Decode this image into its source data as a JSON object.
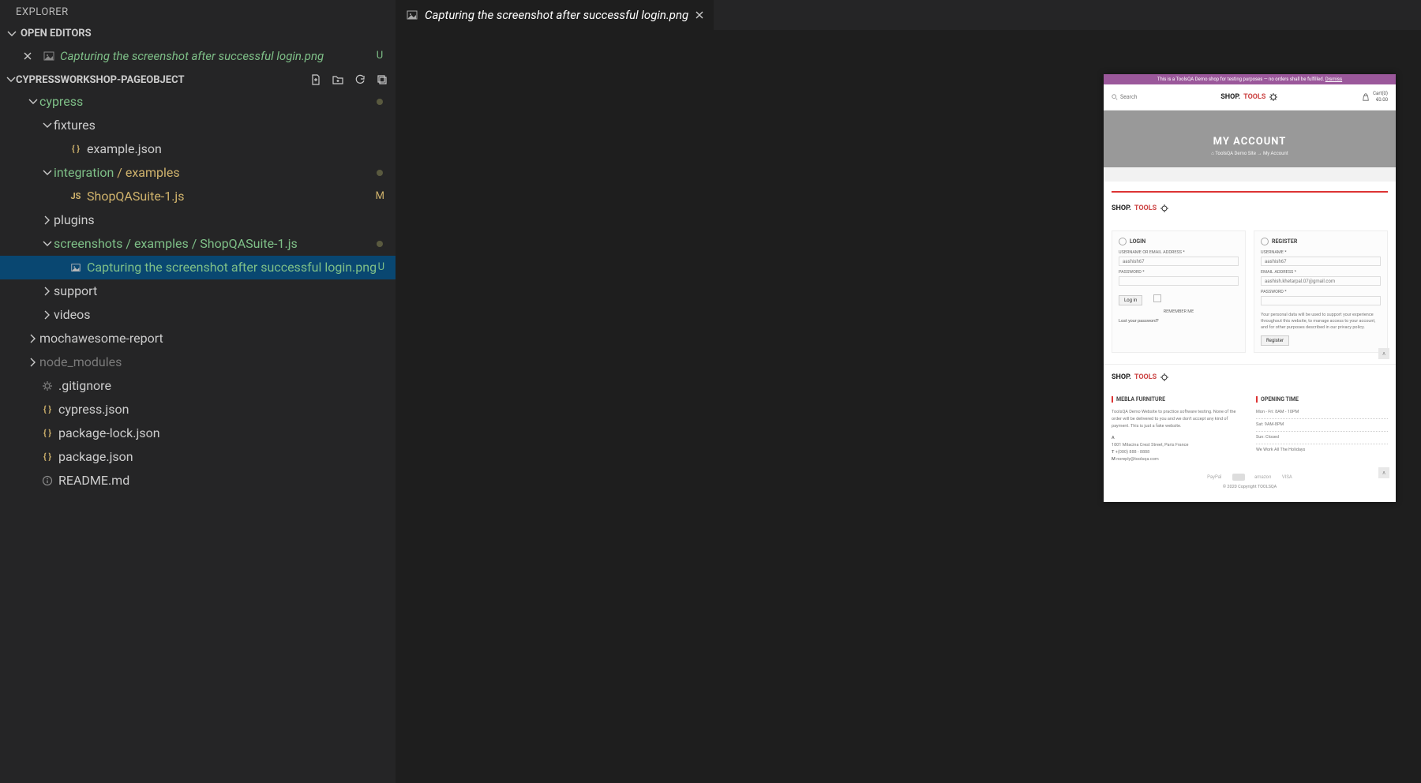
{
  "explorer": {
    "title": "EXPLORER",
    "open_editors_label": "OPEN EDITORS",
    "open_editor": {
      "name": "Capturing the screenshot after successful login.png",
      "status": "U"
    },
    "workspace": "CYPRESSWORKSHOP-PAGEOBJECT",
    "tree": [
      {
        "indent": 1,
        "chev": "down",
        "label": "cypress",
        "color": "green",
        "dot": true
      },
      {
        "indent": 2,
        "chev": "down",
        "label": "fixtures",
        "color": "nocolor"
      },
      {
        "indent": 3,
        "icon": "json",
        "label": "example.json",
        "color": "nocolor"
      },
      {
        "indent": 2,
        "chev": "down",
        "label": "integration",
        "suffix": " / examples",
        "color": "green",
        "suffixcolor": "yellow",
        "dot": true
      },
      {
        "indent": 3,
        "icon": "js",
        "label": "ShopQASuite-1.js",
        "color": "yellow",
        "status": "M",
        "statuscolor": "yellow"
      },
      {
        "indent": 2,
        "chev": "right",
        "label": "plugins",
        "color": "nocolor"
      },
      {
        "indent": 2,
        "chev": "down",
        "label": "screenshots",
        "suffix": " / examples / ShopQASuite-1.js",
        "color": "green",
        "dot": true
      },
      {
        "indent": 3,
        "icon": "img",
        "label": "Capturing the screenshot after successful login.png",
        "color": "green",
        "status": "U",
        "selected": true
      },
      {
        "indent": 2,
        "chev": "right",
        "label": "support",
        "color": "nocolor"
      },
      {
        "indent": 2,
        "chev": "right",
        "label": "videos",
        "color": "nocolor"
      },
      {
        "indent": 1,
        "chev": "right",
        "label": "mochawesome-report",
        "color": "nocolor"
      },
      {
        "indent": 1,
        "chev": "right",
        "label": "node_modules",
        "color": "muted"
      },
      {
        "indent": 1,
        "icon": "cog",
        "label": ".gitignore",
        "color": "nocolor"
      },
      {
        "indent": 1,
        "icon": "json",
        "label": "cypress.json",
        "color": "nocolor"
      },
      {
        "indent": 1,
        "icon": "json",
        "label": "package-lock.json",
        "color": "nocolor"
      },
      {
        "indent": 1,
        "icon": "json",
        "label": "package.json",
        "color": "nocolor"
      },
      {
        "indent": 1,
        "icon": "info",
        "label": "README.md",
        "color": "nocolor"
      }
    ]
  },
  "tab": {
    "name": "Capturing the screenshot after successful login.png"
  },
  "preview": {
    "banner": {
      "text": "This is a ToolsQA Demo shop for testing purposes — no orders shall be fulfilled. ",
      "dismiss": "Dismiss"
    },
    "topbar": {
      "search": "Search",
      "cart_line1": "Cart(0)",
      "cart_line2": "€0.00"
    },
    "logo": {
      "part1": "SHOP.",
      "part2": "TOOLS"
    },
    "hero": {
      "title": "MY ACCOUNT",
      "crumb_home": "ToolsQA Demo Site",
      "crumb_sep": "→",
      "crumb_page": "My Account"
    },
    "login": {
      "heading": "LOGIN",
      "user_label": "USERNAME OR EMAIL ADDRESS *",
      "user_value": "aashish67",
      "pass_label": "PASSWORD *",
      "btn": "Log in",
      "remember": "REMEMBER ME",
      "lost": "Lost your password?"
    },
    "register": {
      "heading": "REGISTER",
      "user_label": "USERNAME *",
      "user_value": "aashish67",
      "email_label": "EMAIL ADDRESS *",
      "email_value": "aashish.khetarpal.07@gmail.com",
      "pass_label": "PASSWORD *",
      "privacy": "Your personal data will be used to support your experience throughout this website, to manage access to your account, and for other purposes described in our privacy policy.",
      "btn": "Register"
    },
    "footer": {
      "col1_title": "MEBLA FURNITURE",
      "col1_about": "ToolsQA Demo Website to practice software testing. None of the order will be delivered to you and we don't accept any kind of payment. This is just a fake website.",
      "addr_label": "A",
      "addr": "1001 Milacina Crest Street, Paris France",
      "tel_label": "T",
      "tel": "+(000) 888 - 8888",
      "mail_label": "M",
      "mail": "noreply@toolsqa.com",
      "col2_title": "OPENING TIME",
      "hours1": "Mon - Fri: 8AM - 10PM",
      "hours2": "Sat: 9AM-8PM",
      "hours3": "Sun: Closed",
      "hours4": "We Work All The Holidays",
      "pay": [
        "PayPal",
        "",
        "amazon",
        "VISA"
      ],
      "copy": "© 2020 Copyright TOOLSQA"
    }
  }
}
